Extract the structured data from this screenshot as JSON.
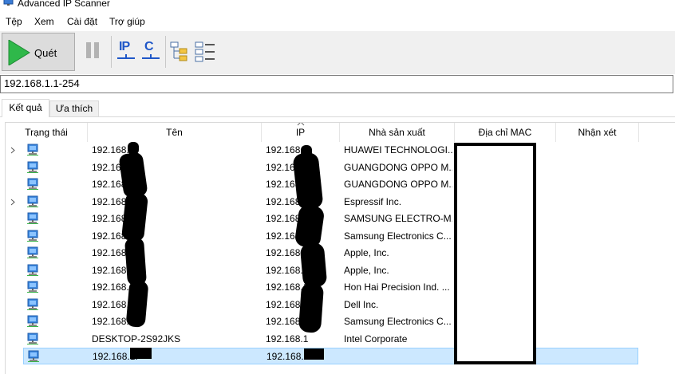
{
  "window": {
    "title": "Advanced IP Scanner"
  },
  "menu": [
    "Tệp",
    "Xem",
    "Cài đặt",
    "Trợ giúp"
  ],
  "toolbar": {
    "scan_label": "Quét",
    "ip_label": "IP",
    "c_label": "C"
  },
  "address": {
    "value": "192.168.1.1-254"
  },
  "tabs": [
    "Kết quả",
    "Ưa thích"
  ],
  "columns": [
    "Trạng thái",
    "Tên",
    "IP",
    "Nhà sản xuất",
    "Địa chỉ MAC",
    "Nhận xét"
  ],
  "rows": [
    {
      "name": "192.168.1.",
      "ip": "192.168.1.",
      "vendor": "HUAWEI TECHNOLOGI...",
      "expand": true
    },
    {
      "name": "192.168.",
      "ip": "192.168.",
      "vendor": "GUANGDONG OPPO M...",
      "expand": false
    },
    {
      "name": "192.168.",
      "ip": "192.168.",
      "vendor": "GUANGDONG OPPO M...",
      "expand": false
    },
    {
      "name": "192.168.",
      "ip": "192.168.",
      "vendor": "Espressif Inc.",
      "expand": true
    },
    {
      "name": "192.168.",
      "ip": "192.168.",
      "vendor": "SAMSUNG ELECTRO-M...",
      "expand": false
    },
    {
      "name": "192.168.1",
      "ip": "192.168.1",
      "vendor": "Samsung Electronics C...",
      "expand": false
    },
    {
      "name": "192.168.1",
      "ip": "192.168.1",
      "vendor": "Apple, Inc.",
      "expand": false
    },
    {
      "name": "192.168.1",
      "ip": "192.168.1",
      "vendor": "Apple, Inc.",
      "expand": false
    },
    {
      "name": "192.168.1",
      "ip": "192.168.1",
      "vendor": "Hon Hai Precision Ind. ...",
      "expand": false
    },
    {
      "name": "192.168.1",
      "ip": "192.168.1",
      "vendor": "Dell Inc.",
      "expand": false
    },
    {
      "name": "192.168.1",
      "ip": "192.168.1",
      "vendor": "Samsung Electronics C...",
      "expand": false
    },
    {
      "name": "DESKTOP-2S92JKS",
      "ip": "192.168.1",
      "vendor": "Intel Corporate",
      "expand": false
    },
    {
      "name": "192.168.1.",
      "ip": "192.168.1",
      "vendor": "",
      "expand": false,
      "selected": true
    }
  ]
}
